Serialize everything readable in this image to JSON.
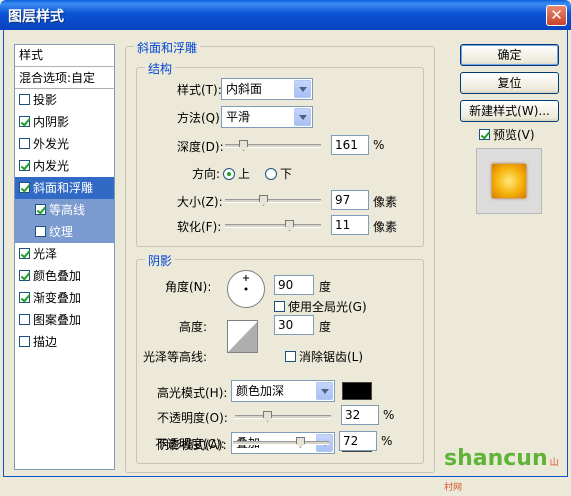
{
  "window": {
    "title": "图层样式",
    "close_label": "✕"
  },
  "style_list": {
    "header": "样式",
    "blend_options": "混合选项:自定",
    "items": [
      {
        "label": "投影",
        "checked": false
      },
      {
        "label": "内阴影",
        "checked": true
      },
      {
        "label": "外发光",
        "checked": false
      },
      {
        "label": "内发光",
        "checked": true
      },
      {
        "label": "斜面和浮雕",
        "checked": true,
        "selected": true
      },
      {
        "label": "等高线",
        "checked": true,
        "sub": true
      },
      {
        "label": "纹理",
        "checked": false,
        "sub": true
      },
      {
        "label": "光泽",
        "checked": true
      },
      {
        "label": "颜色叠加",
        "checked": true
      },
      {
        "label": "渐变叠加",
        "checked": true
      },
      {
        "label": "图案叠加",
        "checked": false
      },
      {
        "label": "描边",
        "checked": false
      }
    ]
  },
  "bevel": {
    "title": "斜面和浮雕",
    "structure": {
      "title": "结构",
      "style_label": "样式(T):",
      "style_value": "内斜面",
      "technique_label": "方法(Q):",
      "technique_value": "平滑",
      "depth_label": "深度(D):",
      "depth_value": "161",
      "depth_unit": "%",
      "depth_level": 0.16,
      "direction_label": "方向:",
      "direction_up": "上",
      "direction_down": "下",
      "size_label": "大小(Z):",
      "size_value": "97",
      "size_unit": "像素",
      "size_level": 0.39,
      "soften_label": "软化(F):",
      "soften_value": "11",
      "soften_unit": "像素",
      "soften_level": 0.69
    },
    "shading": {
      "title": "阴影",
      "angle_label": "角度(N):",
      "angle_value": "90",
      "angle_unit": "度",
      "global_light_label": "使用全局光(G)",
      "altitude_label": "高度:",
      "altitude_value": "30",
      "altitude_unit": "度",
      "gloss_label": "光泽等高线:",
      "antialias_label": "消除锯齿(L)",
      "highlight_mode_label": "高光模式(H):",
      "highlight_mode_value": "颜色加深",
      "highlight_color": "#000000",
      "highlight_opacity_label": "不透明度(O):",
      "highlight_opacity_value": "32",
      "highlight_opacity_unit": "%",
      "highlight_opacity_level": 0.32,
      "shadow_mode_label": "阴影模式(A):",
      "shadow_mode_value": "叠加",
      "shadow_color": "#a09530",
      "shadow_opacity_label": "不透明度(C):",
      "shadow_opacity_value": "72",
      "shadow_opacity_unit": "%",
      "shadow_opacity_level": 0.72
    }
  },
  "buttons": {
    "ok": "确定",
    "reset": "复位",
    "new_style": "新建样式(W)...",
    "preview_label": "预览(V)"
  },
  "watermark": {
    "main": "shancun",
    "tag": "山村网"
  }
}
